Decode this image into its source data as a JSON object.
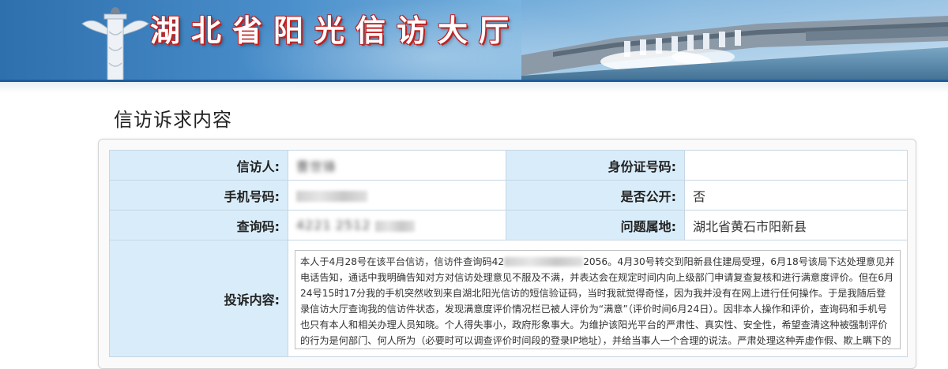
{
  "banner": {
    "title": "湖北省阳光信访大厅",
    "colors": {
      "sky": "#4a8fcb",
      "title_outline": "#c02020"
    }
  },
  "section_title": "信访诉求内容",
  "form": {
    "petitioner": {
      "label": "信访人:",
      "value": "曹世锋"
    },
    "id_number": {
      "label": "身份证号码:",
      "value": ""
    },
    "phone": {
      "label": "手机号码:",
      "value": ""
    },
    "is_public": {
      "label": "是否公开:",
      "value": "否"
    },
    "query_code": {
      "label": "查询码:",
      "value_visible": "4221",
      "value_visible2": "2512"
    },
    "location": {
      "label": "问题属地:",
      "value": "湖北省黄石市阳新县"
    },
    "complaint": {
      "label": "投诉内容:",
      "text_part1": "本人于4月28号在该平台信访，信访件查询码42",
      "text_part2": "2056。4月30号转交到阳新县住建局受理，6月18号该局下达处理意见并电话告知，通话中我明确告知对方对信访处理意见不服及不满，并表达会在规定时间内向上级部门申请复查复核和进行满意度评价。但在6月24号15时17分我的手机突然收到来自湖北阳光信访的短信验证码，当时我就觉得奇怪，因为我并没有在网上进行任何操作。于是我随后登录信访大厅查询我的信访件状态，发现满意度评价情况栏已被人评价为“满意”（评价时间6月24日）。因非本人操作和评价，查询码和手机号也只有本人和相关办理人员知晓。个人得失事小，政府形象事大。为维护该阳光平台的严肃性、真实性、安全性，希望查清这种被强制评价的行为是何部门、何人所为（必要时可以调查评价时间段的登录IP地址），并给当事人一个合理的说法。严肃处理这种弄虚作假、欺上瞒下的行为。"
    }
  }
}
